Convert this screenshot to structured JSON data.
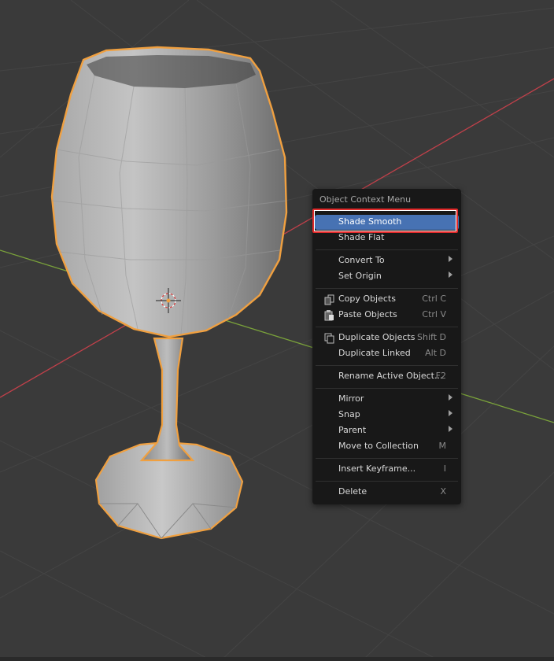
{
  "menu": {
    "title": "Object Context Menu",
    "items": [
      {
        "label": "Shade Smooth",
        "shortcut": "",
        "submenu": false,
        "active": true
      },
      {
        "label": "Shade Flat",
        "shortcut": "",
        "submenu": false
      },
      {
        "label": "Convert To",
        "shortcut": "",
        "submenu": true
      },
      {
        "label": "Set Origin",
        "shortcut": "",
        "submenu": true
      },
      {
        "label": "Copy Objects",
        "shortcut": "Ctrl C",
        "icon": "copy-objects-icon"
      },
      {
        "label": "Paste Objects",
        "shortcut": "Ctrl V",
        "icon": "paste-objects-icon"
      },
      {
        "label": "Duplicate Objects",
        "shortcut": "Shift D",
        "icon": "duplicate-icon"
      },
      {
        "label": "Duplicate Linked",
        "shortcut": "Alt D"
      },
      {
        "label": "Rename Active Object...",
        "shortcut": "F2"
      },
      {
        "label": "Mirror",
        "shortcut": "",
        "submenu": true
      },
      {
        "label": "Snap",
        "shortcut": "",
        "submenu": true
      },
      {
        "label": "Parent",
        "shortcut": "",
        "submenu": true
      },
      {
        "label": "Move to Collection",
        "shortcut": "M"
      },
      {
        "label": "Insert Keyframe...",
        "shortcut": "I"
      },
      {
        "label": "Delete",
        "shortcut": "X"
      }
    ]
  },
  "colors": {
    "viewport_bg": "#3a3a3a",
    "menu_bg": "#181818",
    "highlight": "#4772b3",
    "selection_outline": "#f0a040",
    "x_axis": "#c0404a",
    "y_axis": "#7aa23a",
    "annotation": "#e12a2a"
  }
}
